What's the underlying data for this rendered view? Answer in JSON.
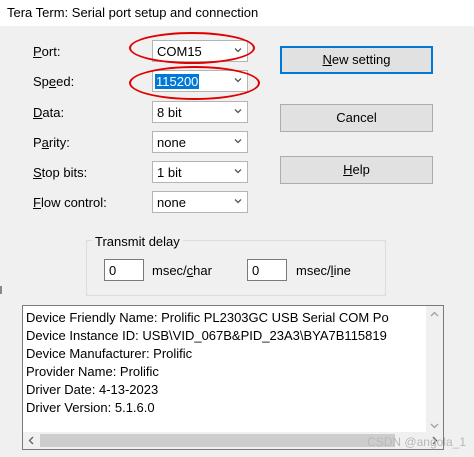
{
  "window": {
    "title": "Tera Term: Serial port setup and connection"
  },
  "form": {
    "port": {
      "label_pre": "",
      "label_u": "P",
      "label_post": "ort:",
      "value": "COM15"
    },
    "speed": {
      "label_pre": "Sp",
      "label_u": "e",
      "label_post": "ed:",
      "value": "115200"
    },
    "data": {
      "label_pre": "",
      "label_u": "D",
      "label_post": "ata:",
      "value": "8 bit"
    },
    "parity": {
      "label_pre": "P",
      "label_u": "a",
      "label_post": "rity:",
      "value": "none"
    },
    "stopbits": {
      "label_pre": "",
      "label_u": "S",
      "label_post": "top bits:",
      "value": "1 bit"
    },
    "flow": {
      "label_pre": "",
      "label_u": "F",
      "label_post": "low control:",
      "value": "none"
    }
  },
  "buttons": {
    "new_setting": {
      "pre": "",
      "u": "N",
      "post": "ew setting"
    },
    "cancel": {
      "label": "Cancel"
    },
    "help": {
      "pre": "",
      "u": "H",
      "post": "elp"
    }
  },
  "transmit_delay": {
    "title": "Transmit delay",
    "char_value": "0",
    "char_unit_pre": "msec/",
    "char_unit_u": "c",
    "char_unit_post": "har",
    "line_value": "0",
    "line_unit_pre": "msec/",
    "line_unit_u": "l",
    "line_unit_post": "ine"
  },
  "device_info": [
    "Device Friendly Name: Prolific PL2303GC USB Serial COM Po",
    "Device Instance ID: USB\\VID_067B&PID_23A3\\BYA7B115819",
    "Device Manufacturer: Prolific",
    "Provider Name: Prolific",
    "Driver Date: 4-13-2023",
    "Driver Version: 5.1.6.0"
  ],
  "watermark": "CSDN @angola_1",
  "colors": {
    "annotation": "#e00000",
    "selection": "#0078d7"
  },
  "icons": {
    "dropdown": "chevron-down-icon",
    "scroll_up": "arrow-up-icon",
    "scroll_down": "arrow-down-icon",
    "scroll_left": "arrow-left-icon",
    "scroll_right": "arrow-right-icon"
  }
}
